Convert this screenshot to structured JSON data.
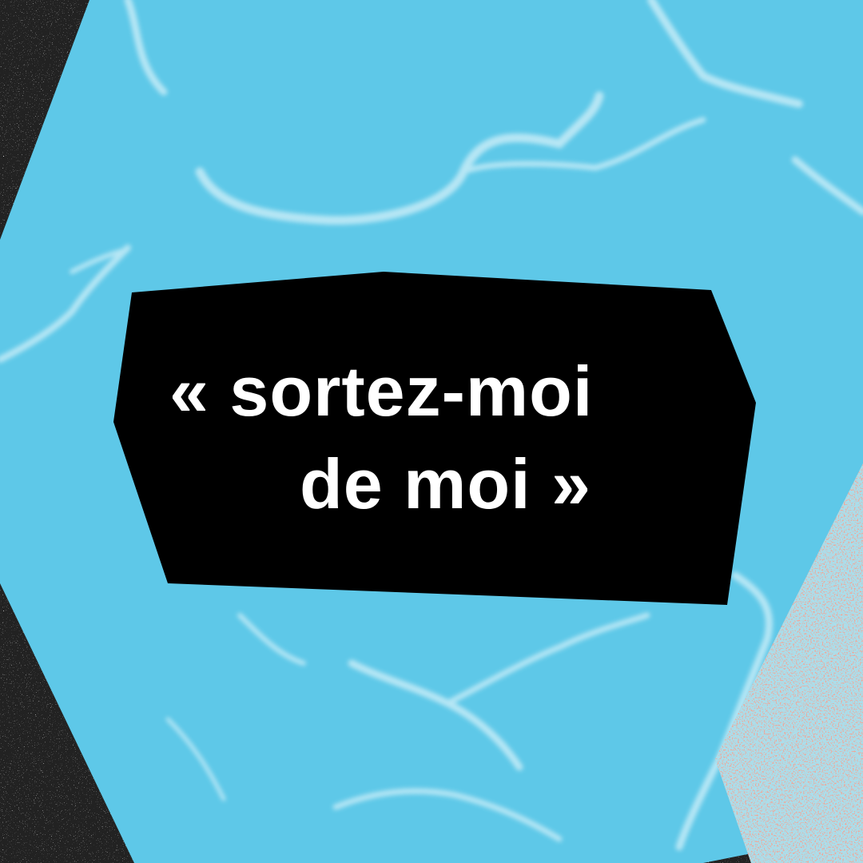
{
  "quote": {
    "line1": "« sortez-moi",
    "line2": "de moi »"
  },
  "colors": {
    "background_gray": "#e8e8e8",
    "water_blue": "#5ec8e8",
    "ripple_white": "#bfeaf6",
    "label_black": "#000000",
    "text_white": "#ffffff",
    "coral": "#f2a596"
  }
}
